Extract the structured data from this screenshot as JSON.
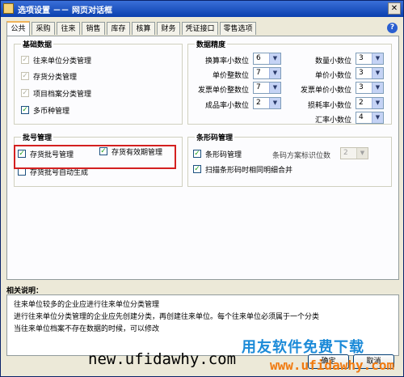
{
  "window": {
    "title": "选项设置 －－ 网页对话框",
    "close_glyph": "✕"
  },
  "tabs": [
    "公共",
    "采购",
    "往来",
    "销售",
    "库存",
    "核算",
    "财务",
    "凭证接口",
    "零售选项"
  ],
  "active_tab": "公共",
  "help_glyph": "?",
  "basic_data": {
    "title": "基础数据",
    "items": [
      {
        "label": "往来单位分类管理",
        "checked": true,
        "enabled": false
      },
      {
        "label": "存货分类管理",
        "checked": true,
        "enabled": false
      },
      {
        "label": "项目档案分类管理",
        "checked": true,
        "enabled": false
      },
      {
        "label": "多币种管理",
        "checked": true,
        "enabled": true
      }
    ]
  },
  "precision": {
    "title": "数据精度",
    "left": [
      {
        "label": "换算率小数位",
        "value": "6"
      },
      {
        "label": "单价整数位",
        "value": "7"
      },
      {
        "label": "发票单价整数位",
        "value": "7"
      },
      {
        "label": "成品率小数位",
        "value": "2"
      }
    ],
    "right": [
      {
        "label": "数量小数位",
        "value": "3"
      },
      {
        "label": "单价小数位",
        "value": "3"
      },
      {
        "label": "发票单价小数位",
        "value": "3"
      },
      {
        "label": "损耗率小数位",
        "value": "2"
      },
      {
        "label": "汇率小数位",
        "value": "4"
      }
    ]
  },
  "batch": {
    "title": "批号管理",
    "items": [
      {
        "label": "存货批号管理",
        "checked": true
      },
      {
        "label": "存货有效期管理",
        "checked": true
      },
      {
        "label": "存货批号自动生成",
        "checked": false
      }
    ]
  },
  "barcode": {
    "title": "条形码管理",
    "manage_label": "条形码管理",
    "manage_checked": true,
    "scheme_label": "条码方案标识位数",
    "scheme_value": "2",
    "scan_label": "扫描条形码时相同明细合并",
    "scan_checked": true
  },
  "description": {
    "title": "相关说明：",
    "lines": [
      "往来单位较多的企业应进行往来单位分类管理",
      "进行往来单位分类管理的企业应先创建分类，再创建往来单位。每个往来单位必须属于一个分类",
      "当往来单位档案不存在数据的时候，可以修改"
    ]
  },
  "buttons": {
    "ok": "确定",
    "cancel": "取消"
  },
  "watermark": {
    "brand": "用友软件免费下载",
    "url_main": "new.ufidawhy.com",
    "url_alt": "www.ufidawhy.com"
  },
  "icons": {
    "check": "✓",
    "dropdown": "▼"
  }
}
